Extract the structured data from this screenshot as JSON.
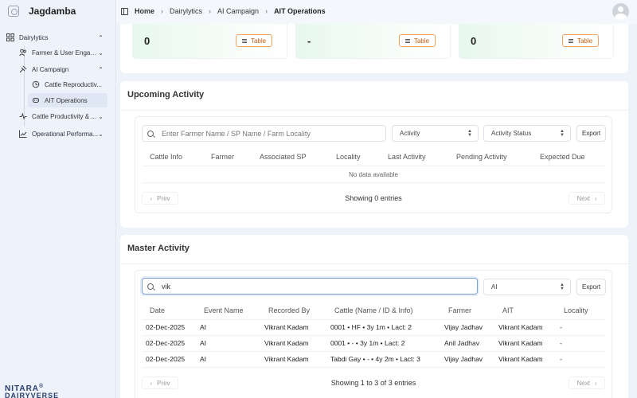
{
  "app": {
    "brand": "Jagdamba",
    "footer_logo_top": "NITARA",
    "footer_logo_mark": "®",
    "footer_logo_bottom": "DAIRYVERSE"
  },
  "sidebar": {
    "dairylytics": "Dairylytics",
    "farmer_engagement": "Farmer & User Engag...",
    "ai_campaign": "AI Campaign",
    "cattle_reproduction": "Cattle Reproductiv...",
    "ait_operations": "AIT Operations",
    "cattle_productivity": "Cattle Productivity & ...",
    "operational_performance": "Operational Performa..."
  },
  "breadcrumb": {
    "home": "Home",
    "dairylytics": "Dairylytics",
    "ai_campaign": "AI Campaign",
    "current": "AIT Operations"
  },
  "stats": [
    {
      "value": "0",
      "button": "Table"
    },
    {
      "value": "-",
      "button": "Table"
    },
    {
      "value": "0",
      "button": "Table"
    }
  ],
  "upcoming": {
    "title": "Upcoming Activity",
    "search_placeholder": "Enter Farmer Name / SP Name / Farm Locality",
    "activity_select": "Activity",
    "status_select": "Activity Status",
    "export": "Export",
    "columns": [
      "Cattle Info",
      "Farmer",
      "Associated SP",
      "Locality",
      "Last Activity",
      "Pending Activity",
      "Expected Due"
    ],
    "empty": "No data available",
    "prev": "Prev",
    "next": "Next",
    "showing": "Showing 0 entries"
  },
  "master": {
    "title": "Master Activity",
    "search_value": "vik",
    "ai_select": "AI",
    "export": "Export",
    "columns": [
      "Date",
      "Event Name",
      "Recorded By",
      "Cattle (Name / ID & Info)",
      "Farmer",
      "AIT",
      "Locality"
    ],
    "rows": [
      [
        "02-Dec-2025",
        "AI",
        "Vikrant Kadam",
        "0001 • HF • 3y 1m • Lact: 2",
        "Vijay Jadhav",
        "Vikrant Kadam",
        "-"
      ],
      [
        "02-Dec-2025",
        "AI",
        "Vikrant Kadam",
        "0001 • - • 3y 1m • Lact: 2",
        "Anil Jadhav",
        "Vikrant Kadam",
        "-"
      ],
      [
        "02-Dec-2025",
        "AI",
        "Vikrant Kadam",
        "Tabdi Gay • - • 4y 2m • Lact: 3",
        "Vijay Jadhav",
        "Vikrant Kadam",
        "-"
      ]
    ],
    "prev": "Prev",
    "next": "Next",
    "showing": "Showing 1 to 3 of 3 entries"
  },
  "colors": {
    "accent_orange": "#f2a35f",
    "card_green": "#e8f8ee",
    "active_nav": "#dfe7f5"
  }
}
